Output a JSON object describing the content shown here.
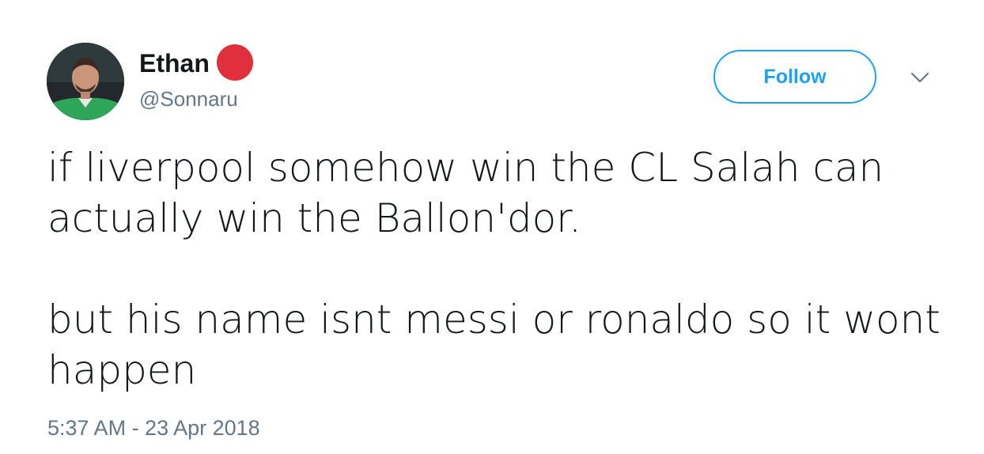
{
  "user": {
    "display_name": "Ethan",
    "handle": "@Sonnaru",
    "badge_color": "#e0303e"
  },
  "actions": {
    "follow_label": "Follow",
    "menu_icon": "chevron-down-icon"
  },
  "tweet": {
    "paragraph_1": "if liverpool somehow win the CL Salah can actually win the Ballon'dor.",
    "paragraph_2": "but his name isnt messi or ronaldo so it wont happen",
    "timestamp": "5:37 AM - 23 Apr 2018"
  },
  "colors": {
    "accent": "#1da1f2",
    "text": "#14171a",
    "muted": "#657786"
  }
}
